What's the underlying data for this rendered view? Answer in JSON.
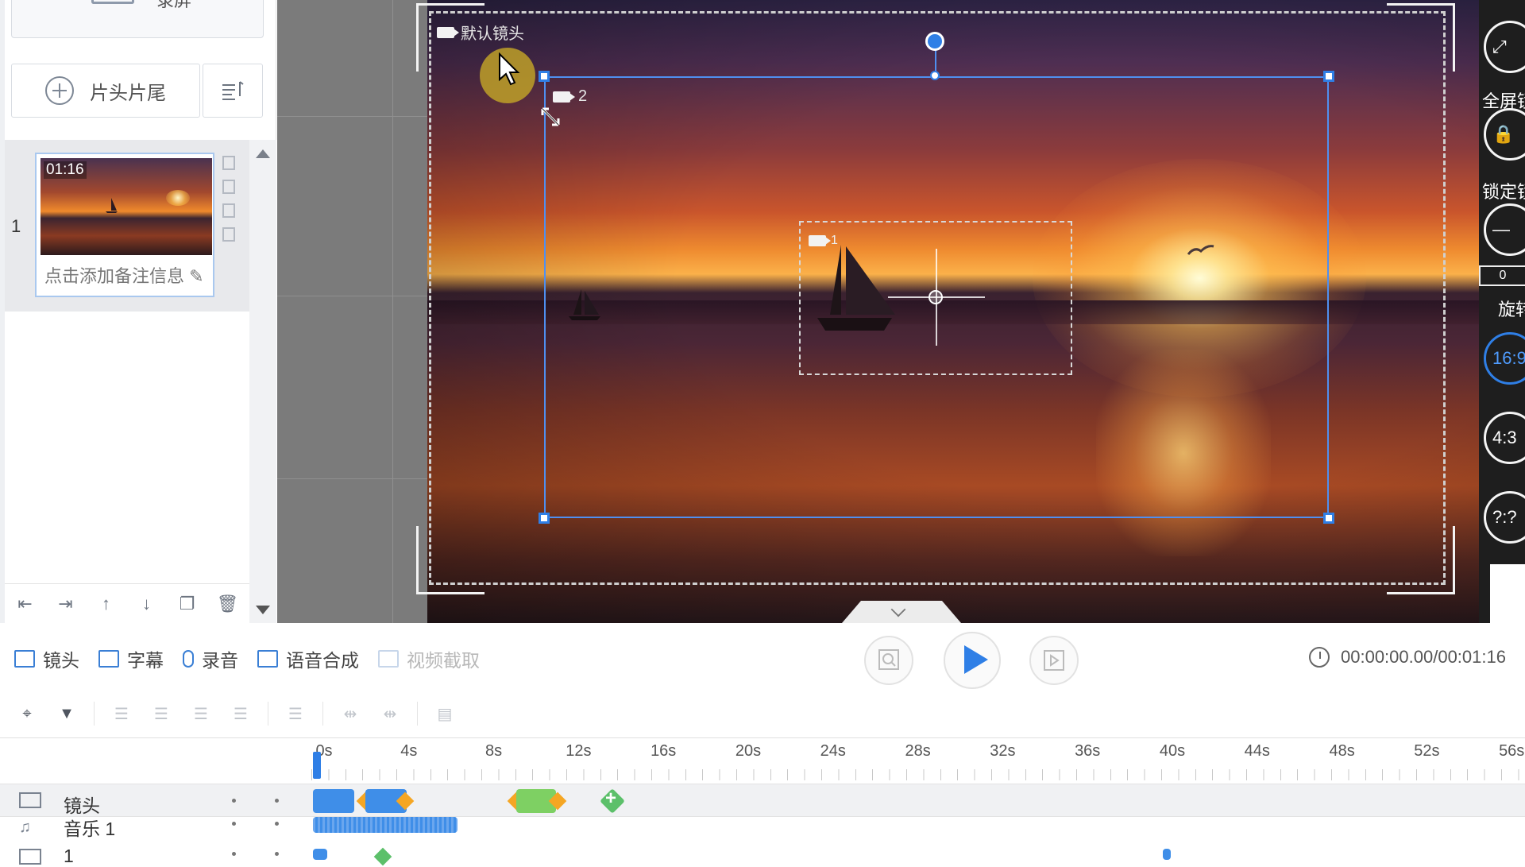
{
  "left_panel": {
    "record_label": "录屏",
    "intro_outro_label": "片头片尾",
    "scene_number": "1",
    "scene_duration": "01:16",
    "scene_note_placeholder": "点击添加备注信息"
  },
  "canvas": {
    "default_camera_label": "默认镜头",
    "camera2_label": "2",
    "camera1_label": "1"
  },
  "right_toolbar": {
    "fullscreen_label": "全屏镜",
    "lock_label": "锁定镜",
    "rotation_value": "0",
    "rotation_label": "旋转",
    "ratio_16_9": "16:9",
    "ratio_4_3": "4:3",
    "ratio_custom": "?:?"
  },
  "tool_tabs": [
    {
      "label": "镜头",
      "icon": "camera-icon"
    },
    {
      "label": "字幕",
      "icon": "subtitle-icon"
    },
    {
      "label": "录音",
      "icon": "microphone-icon"
    },
    {
      "label": "语音合成",
      "icon": "speech-synthesis-icon"
    },
    {
      "label": "视频截取",
      "icon": "video-cut-icon"
    }
  ],
  "playback": {
    "time": "00:00:00.00/00:01:16"
  },
  "timeline": {
    "ticks": [
      "0s",
      "4s",
      "8s",
      "12s",
      "16s",
      "20s",
      "24s",
      "28s",
      "32s",
      "36s",
      "40s",
      "44s",
      "48s",
      "52s",
      "56s"
    ],
    "tracks": [
      {
        "name": "镜头",
        "icon": "camera-icon"
      },
      {
        "name": "音乐 1",
        "icon": "music-icon"
      },
      {
        "name": "1",
        "icon": "image-icon"
      }
    ]
  },
  "colors": {
    "accent": "#2f7fe6",
    "keyframe_orange": "#f5a623",
    "clip_green": "#7ed063",
    "add_green": "#5cc06a"
  }
}
